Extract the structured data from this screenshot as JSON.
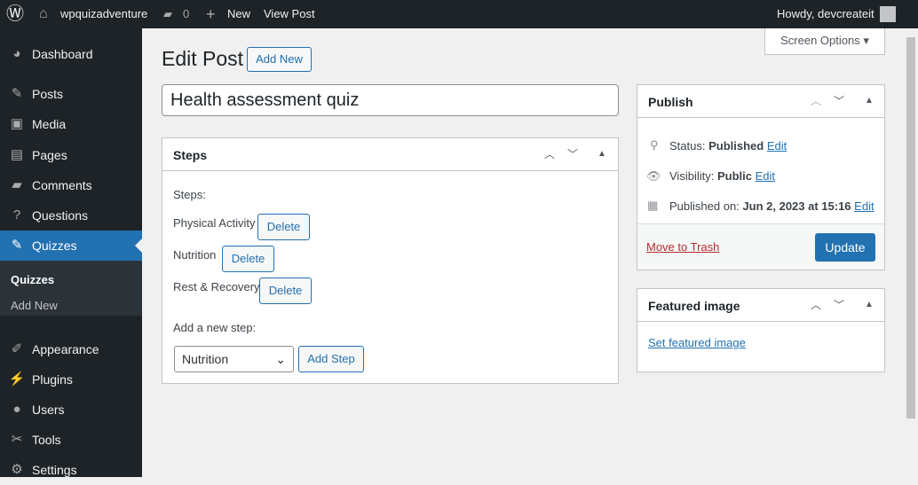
{
  "adminbar": {
    "site": "wpquizadventure",
    "comments": "0",
    "new": "New",
    "view": "View Post",
    "howdy": "Howdy, devcreateit"
  },
  "sidebar": {
    "items": [
      {
        "label": "Dashboard",
        "icon": "dashboard-icon",
        "glyph": "◕"
      },
      {
        "label": "Posts",
        "icon": "pin-icon",
        "glyph": "✎"
      },
      {
        "label": "Media",
        "icon": "media-icon",
        "glyph": "▣"
      },
      {
        "label": "Pages",
        "icon": "pages-icon",
        "glyph": "▤"
      },
      {
        "label": "Comments",
        "icon": "comment-icon",
        "glyph": "▰"
      },
      {
        "label": "Questions",
        "icon": "question-icon",
        "glyph": "?"
      },
      {
        "label": "Quizzes",
        "icon": "pin-icon",
        "glyph": "✎"
      },
      {
        "label": "Appearance",
        "icon": "brush-icon",
        "glyph": "✐"
      },
      {
        "label": "Plugins",
        "icon": "plugin-icon",
        "glyph": "⚡"
      },
      {
        "label": "Users",
        "icon": "user-icon",
        "glyph": "●"
      },
      {
        "label": "Tools",
        "icon": "wrench-icon",
        "glyph": "✂"
      },
      {
        "label": "Settings",
        "icon": "settings-icon",
        "glyph": "⚙"
      }
    ],
    "submenu": [
      "Quizzes",
      "Add New"
    ]
  },
  "screen_options": "Screen Options ▾",
  "page_title": "Edit Post",
  "add_new": "Add New",
  "post_title": "Health assessment quiz",
  "steps": {
    "title": "Steps",
    "label": "Steps:",
    "items": [
      "Physical Activity",
      "Nutrition",
      "Rest & Recovery"
    ],
    "delete": "Delete",
    "add_label": "Add a new step:",
    "select_value": "Nutrition",
    "add_button": "Add Step"
  },
  "publish": {
    "title": "Publish",
    "status_label": "Status:",
    "status": "Published",
    "visibility_label": "Visibility:",
    "visibility": "Public",
    "published_label": "Published on:",
    "published": "Jun 2, 2023 at 15:16",
    "edit": "Edit",
    "trash": "Move to Trash",
    "update": "Update"
  },
  "featured": {
    "title": "Featured image",
    "link": "Set featured image"
  },
  "colors": {
    "accent": "#2271b1",
    "sidebar": "#1d2327",
    "trash": "#b32d2e"
  }
}
